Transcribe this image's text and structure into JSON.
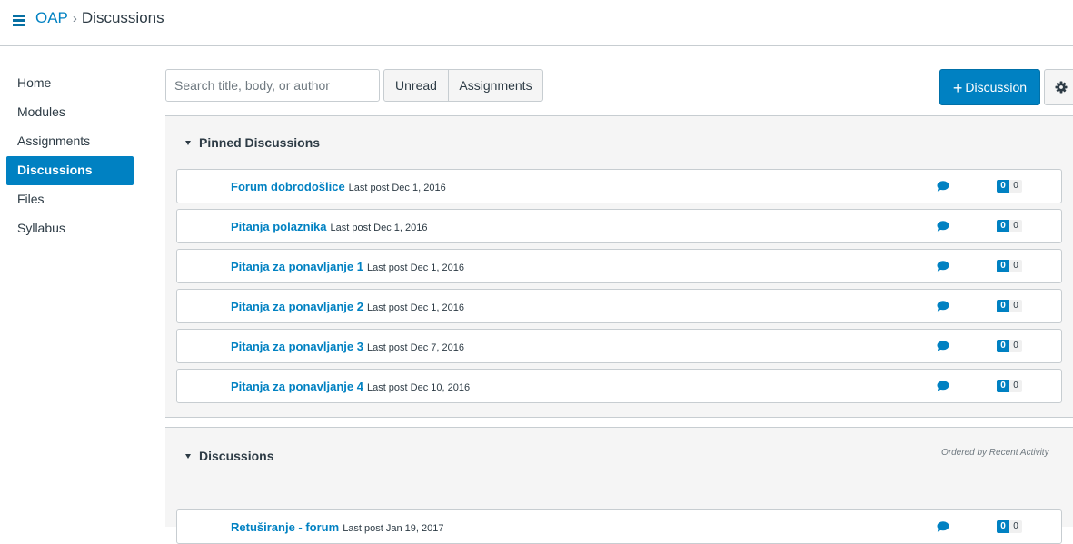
{
  "header": {
    "menu_icon": "hamburger-icon",
    "course": "OAP",
    "separator": "›",
    "current": "Discussions"
  },
  "nav": {
    "items": [
      {
        "label": "Home",
        "active": false
      },
      {
        "label": "Modules",
        "active": false
      },
      {
        "label": "Assignments",
        "active": false
      },
      {
        "label": "Discussions",
        "active": true
      },
      {
        "label": "Files",
        "active": false
      },
      {
        "label": "Syllabus",
        "active": false
      }
    ]
  },
  "toolbar": {
    "search_placeholder": "Search title, body, or author",
    "filter_unread": "Unread",
    "filter_assignments": "Assignments",
    "add_plus": "+",
    "add_label": "Discussion",
    "settings_icon": "gear-icon"
  },
  "pinned": {
    "heading": "Pinned Discussions",
    "rows": [
      {
        "title": "Forum dobrodošlice",
        "meta": "Last post Dec 1, 2016",
        "unread": "0",
        "total": "0"
      },
      {
        "title": "Pitanja polaznika",
        "meta": "Last post Dec 1, 2016",
        "unread": "0",
        "total": "0"
      },
      {
        "title": "Pitanja za ponavljanje 1",
        "meta": "Last post Dec 1, 2016",
        "unread": "0",
        "total": "0"
      },
      {
        "title": "Pitanja za ponavljanje 2",
        "meta": "Last post Dec 1, 2016",
        "unread": "0",
        "total": "0"
      },
      {
        "title": "Pitanja za ponavljanje 3",
        "meta": "Last post Dec 7, 2016",
        "unread": "0",
        "total": "0"
      },
      {
        "title": "Pitanja za ponavljanje 4",
        "meta": "Last post Dec 10, 2016",
        "unread": "0",
        "total": "0"
      }
    ]
  },
  "discussions": {
    "heading": "Discussions",
    "order_note": "Ordered by Recent Activity",
    "rows": [
      {
        "title": "Retuširanje - forum",
        "meta": "Last post Jan 19, 2017",
        "unread": "0",
        "total": "0"
      }
    ]
  },
  "colors": {
    "accent": "#0081c2",
    "text": "#2d3b45",
    "border": "#c7cdd1",
    "section_bg": "#f5f5f5"
  }
}
